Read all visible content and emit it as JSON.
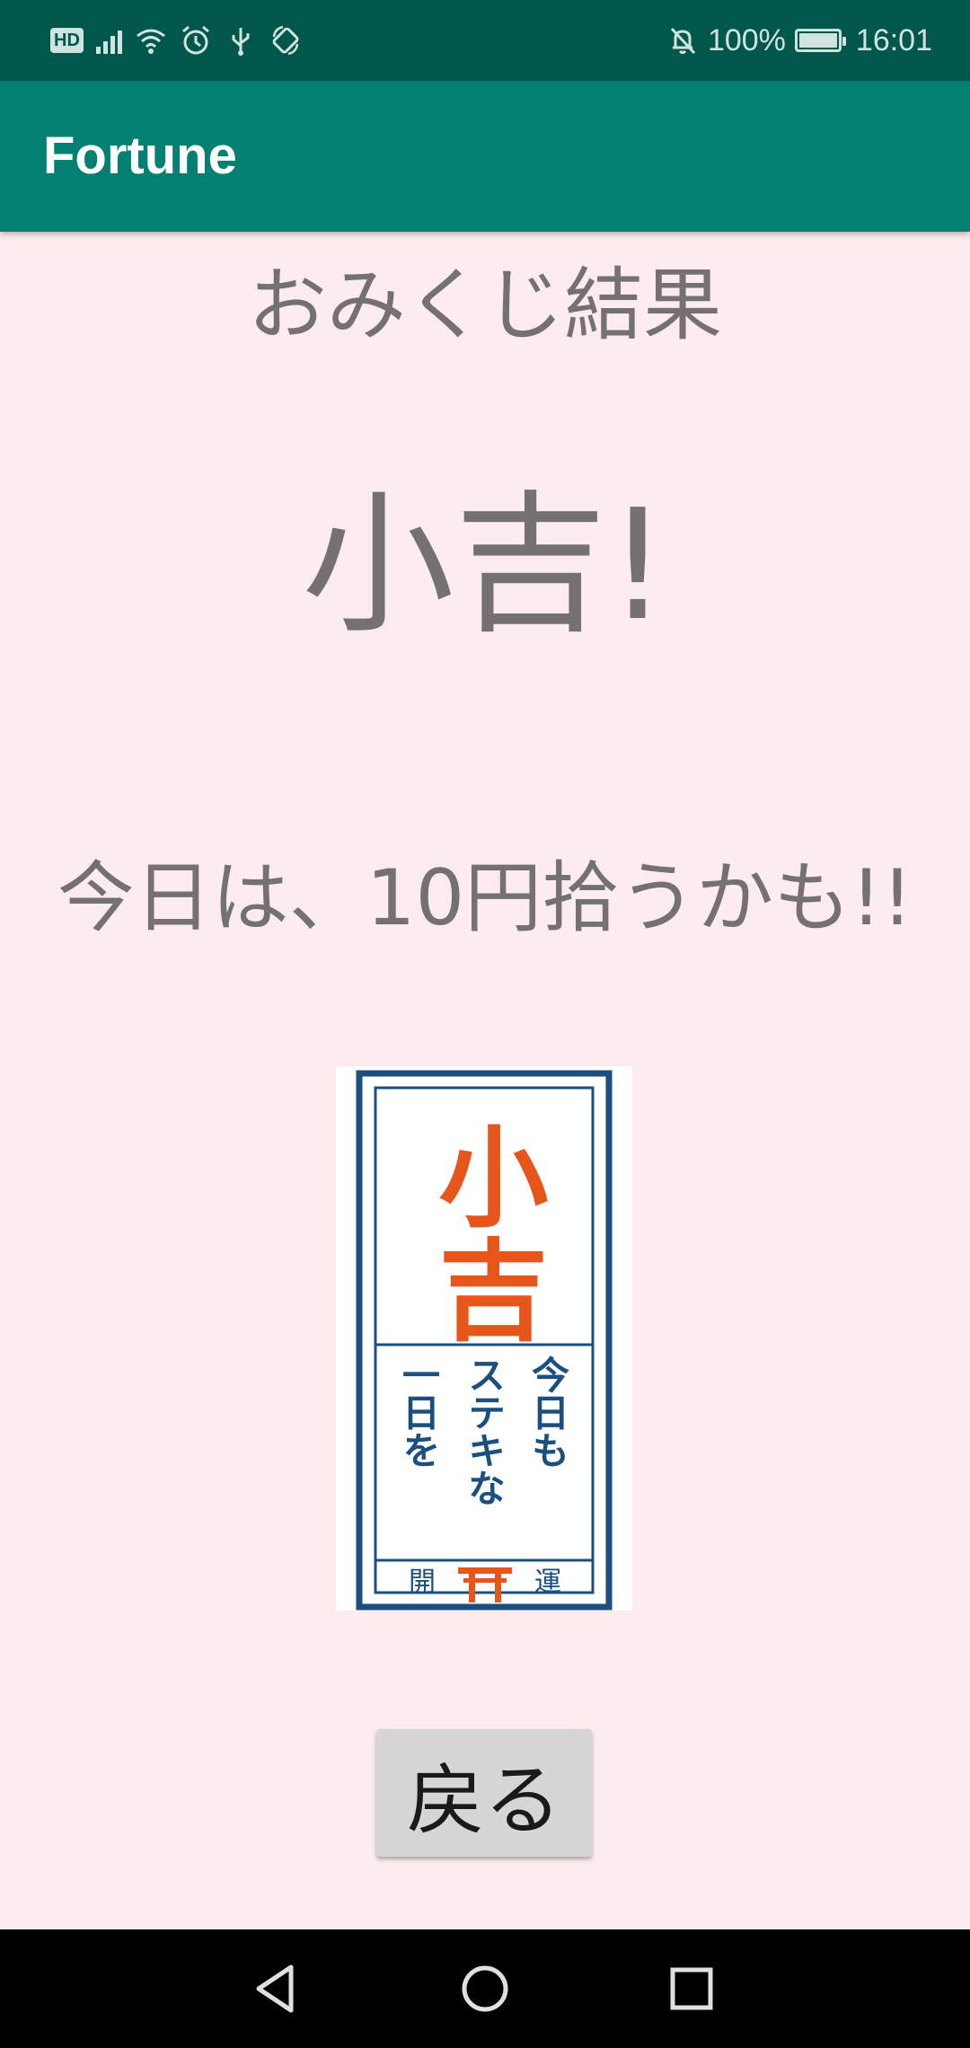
{
  "status_bar": {
    "left_icons": [
      "hd-icon",
      "signal-icon",
      "wifi-icon",
      "alarm-icon",
      "usb-icon",
      "auto-rotate-icon"
    ],
    "hd_label": "HD",
    "right_icons": [
      "notifications-off-icon",
      "battery-icon"
    ],
    "battery_percent": "100%",
    "battery_level": 1.0,
    "time": "16:01"
  },
  "app_bar": {
    "title": "Fortune",
    "color": "#038072"
  },
  "main": {
    "heading": "おみくじ結果",
    "rank": "小吉!",
    "message": "今日は、10円拾うかも!!",
    "image": {
      "rank_text": "小吉",
      "columns": [
        "今日も",
        "ステキな",
        "一日を"
      ],
      "footer_left": "開",
      "footer_right": "運",
      "border_color": "#1b4f80",
      "rank_color": "#e6561b"
    },
    "back_button_label": "戻る"
  },
  "nav_bar": {
    "buttons": [
      "back-icon",
      "home-icon",
      "recents-icon"
    ]
  },
  "colors": {
    "background": "#fdeced",
    "status_bar": "#01574c",
    "text": "#757171"
  }
}
